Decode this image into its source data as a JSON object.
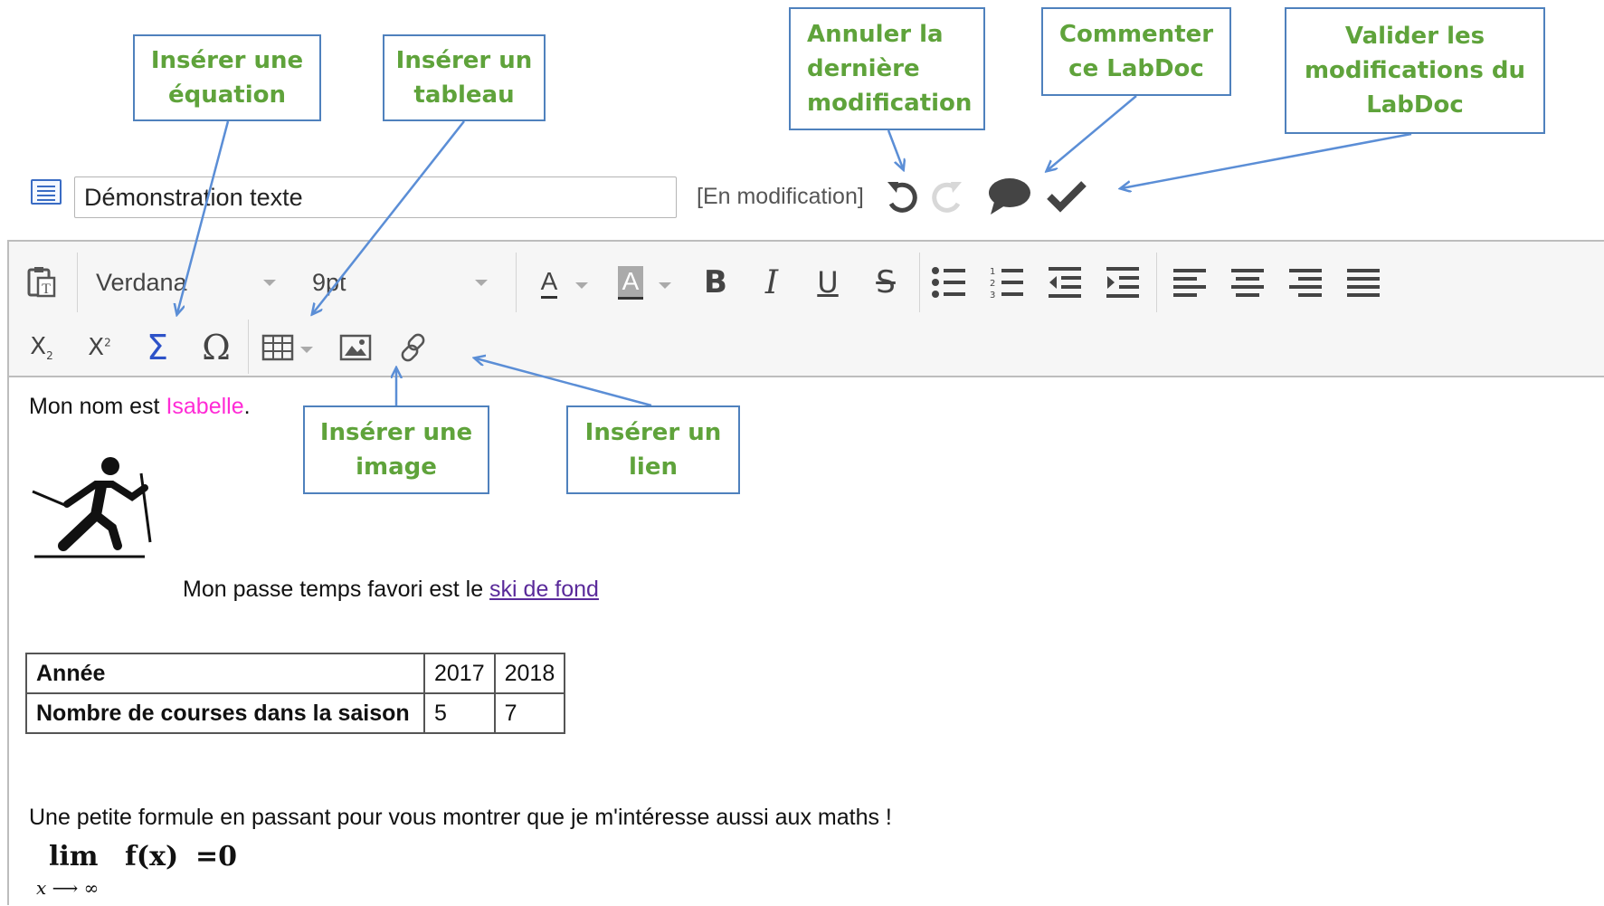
{
  "title_bar": {
    "doc_title_value": "Démonstration texte",
    "status": "[En modification]"
  },
  "toolbar": {
    "font_family": "Verdana",
    "font_size": "9pt",
    "text_color_glyph": "A",
    "bg_color_glyph": "A",
    "bold_glyph": "B",
    "italic_glyph": "I",
    "underline_glyph": "U",
    "strike_glyph": "S",
    "subscript_glyph": "X",
    "subscript_sub": "2",
    "superscript_glyph": "X",
    "superscript_sup": "2",
    "equation_glyph": "Σ",
    "special_char_glyph": "Ω"
  },
  "content": {
    "intro_prefix": "Mon nom est ",
    "name": "Isabelle",
    "intro_suffix": ".",
    "hobby_prefix": "Mon passe temps favori est le ",
    "hobby_link": "ski de fond",
    "table": {
      "header_label": "Année",
      "years": [
        "2017",
        "2018"
      ],
      "row_label": "Nombre de courses dans la saison",
      "values": [
        "5",
        "7"
      ]
    },
    "formula_intro": "Une petite formule en passant pour vous montrer que je m'intéresse aussi aux maths !",
    "formula": {
      "lim": "lim",
      "function": "f(x)",
      "equals": "=0",
      "subscript": "x ⟶ ∞"
    }
  },
  "callouts": {
    "equation": "Insérer une\néquation",
    "table": "Insérer un\ntableau",
    "undo": "Annuler la\ndernière\nmodification",
    "comment": "Commenter\nce LabDoc",
    "validate": "Valider les\nmodifications du\nLabDoc",
    "image": "Insérer une\nimage",
    "link": "Insérer un\nlien"
  },
  "colors": {
    "callout_border": "#4f81bd",
    "callout_text": "#5fa33b",
    "arrow": "#5b8ed6",
    "highlight_name": "#ff2bd6",
    "link": "#5a2a9a",
    "equation_icon": "#2d52c8"
  },
  "icons": [
    "doc-icon",
    "undo-icon",
    "redo-icon",
    "comment-icon",
    "check-icon",
    "paste-text-icon",
    "bullet-list-icon",
    "numbered-list-icon",
    "outdent-icon",
    "indent-icon",
    "align-left-icon",
    "align-center-icon",
    "align-right-icon",
    "justify-icon",
    "table-icon",
    "image-icon",
    "link-icon",
    "skier-pictogram"
  ]
}
